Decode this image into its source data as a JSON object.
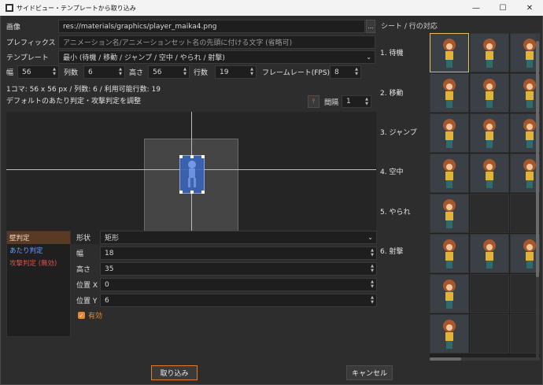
{
  "window": {
    "title": "サイドビュー・テンプレートから取り込み",
    "minimize": "—",
    "maximize": "☐",
    "close": "✕"
  },
  "form": {
    "image_label": "画像",
    "image_value": "res://materials/graphics/player_maika4.png",
    "image_browse": "...",
    "prefix_label": "プレフィックス",
    "prefix_placeholder": "アニメーション名/アニメーションセット名の先頭に付ける文字 (省略可)",
    "template_label": "テンプレート",
    "template_value": "最小 (待機 / 移動 / ジャンプ / 空中 / やられ / 射撃)",
    "width_label": "幅",
    "width_value": "56",
    "cols_label": "列数",
    "cols_value": "6",
    "height_label": "高さ",
    "height_value": "56",
    "rows_label": "行数",
    "rows_value": "19",
    "fps_label": "フレームレート(FPS)",
    "fps_value": "8",
    "info_text": "1コマ: 56 x 56 px / 列数: 6 / 利用可能行数: 19",
    "hitbox_adjust_label": "デフォルトのあたり判定・攻撃判定を調整",
    "interval_label": "間隔",
    "interval_value": "1"
  },
  "collision_list": {
    "items": [
      {
        "label": "壁判定",
        "color": "#f0d9c4"
      },
      {
        "label": "あたり判定",
        "color": "#6f9cff"
      },
      {
        "label": "攻撃判定 (無効)",
        "color": "#e05050"
      }
    ]
  },
  "props": {
    "shape_label": "形状",
    "shape_value": "矩形",
    "width_label": "幅",
    "width_value": "18",
    "height_label": "高さ",
    "height_value": "35",
    "posx_label": "位置 X",
    "posx_value": "0",
    "posy_label": "位置 Y",
    "posy_value": "6",
    "enabled_label": "有効"
  },
  "sheet": {
    "header": "シート / 行の対応",
    "rows": [
      {
        "label": "1. 待機"
      },
      {
        "label": "2. 移動"
      },
      {
        "label": "3. ジャンプ"
      },
      {
        "label": "4. 空中"
      },
      {
        "label": "5. やられ"
      },
      {
        "label": "6. 射撃"
      }
    ]
  },
  "buttons": {
    "import": "取り込み",
    "cancel": "キャンセル"
  },
  "colors": {
    "accent": "#e07a2c",
    "hitbox": "#3a63b8",
    "selection": "#e6c15a"
  }
}
